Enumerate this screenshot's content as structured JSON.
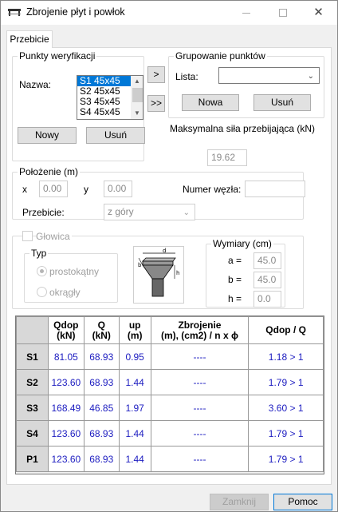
{
  "window": {
    "title": "Zbrojenie płyt i powłok"
  },
  "tabs": [
    {
      "label": "Przebicie"
    }
  ],
  "verification_points": {
    "legend": "Punkty weryfikacji",
    "name_label": "Nazwa:",
    "items": [
      "S1 45x45",
      "S2 45x45",
      "S3 45x45",
      "S4 45x45"
    ],
    "selected_index": 0,
    "new_button": "Nowy",
    "delete_button": "Usuń",
    "add_button": ">",
    "add_all_button": ">>"
  },
  "grouping": {
    "legend": "Grupowanie punktów",
    "list_label": "Lista:",
    "list_value": "",
    "new_button": "Nowa",
    "delete_button": "Usuń"
  },
  "max_force": {
    "label": "Maksymalna siła przebijająca (kN)",
    "value": "19.62"
  },
  "position": {
    "legend": "Położenie (m)",
    "x_label": "x",
    "x_value": "0.00",
    "y_label": "y",
    "y_value": "0.00",
    "node_label": "Numer węzła:",
    "node_value": "",
    "punching_label": "Przebicie:",
    "punching_value": "z góry"
  },
  "head": {
    "checkbox_label": "Głowica",
    "type_legend": "Typ",
    "rect_label": "prostokątny",
    "round_label": "okrągły",
    "dims_legend": "Wymiary (cm)",
    "a_label": "a =",
    "a_value": "45.0",
    "b_label": "b =",
    "b_value": "45.0",
    "h_label": "h =",
    "h_value": "0.0",
    "diagram_labels": {
      "b": "b",
      "d": "d",
      "h": "h"
    }
  },
  "table": {
    "headers": [
      "Qdop\n(kN)",
      "Q\n(kN)",
      "up\n(m)",
      "Zbrojenie\n(m), (cm2) / n x ϕ",
      "Qdop / Q"
    ],
    "header_lines": [
      [
        "Qdop",
        "(kN)"
      ],
      [
        "Q",
        "(kN)"
      ],
      [
        "up",
        "(m)"
      ],
      [
        "Zbrojenie",
        "(m), (cm2) / n x ϕ"
      ],
      [
        "Qdop / Q"
      ]
    ],
    "rows": [
      {
        "name": "S1",
        "qdop": "81.05",
        "q": "68.93",
        "up": "0.95",
        "reinf": "----",
        "ratio": "1.18 > 1"
      },
      {
        "name": "S2",
        "qdop": "123.60",
        "q": "68.93",
        "up": "1.44",
        "reinf": "----",
        "ratio": "1.79 > 1"
      },
      {
        "name": "S3",
        "qdop": "168.49",
        "q": "46.85",
        "up": "1.97",
        "reinf": "----",
        "ratio": "3.60 > 1"
      },
      {
        "name": "S4",
        "qdop": "123.60",
        "q": "68.93",
        "up": "1.44",
        "reinf": "----",
        "ratio": "1.79 > 1"
      },
      {
        "name": "P1",
        "qdop": "123.60",
        "q": "68.93",
        "up": "1.44",
        "reinf": "----",
        "ratio": "1.79 > 1"
      }
    ]
  },
  "footer": {
    "close_button": "Zamknij",
    "help_button": "Pomoc"
  },
  "colors": {
    "selection": "#0078d7",
    "table_values": "#1c1cc0"
  }
}
